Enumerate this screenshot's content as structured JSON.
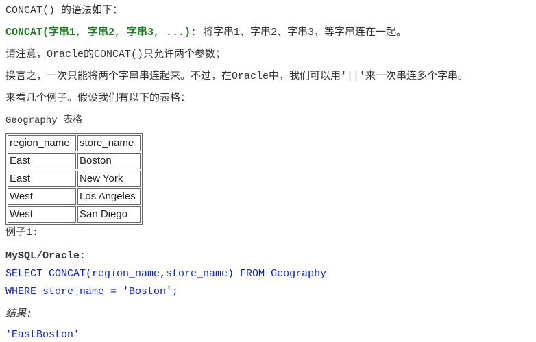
{
  "lines": {
    "intro": "CONCAT() 的语法如下：",
    "syntax_code": "CONCAT(字串1, 字串2, 字串3, ...)",
    "syntax_desc": ": 将字串1、字串2、字串3，等字串连在一起。",
    "note1": "请注意，Oracle的CONCAT()只允许两个参数；",
    "note2": "换言之，一次只能将两个字串串连起来。不过，在Oracle中，我们可以用'||'来一次串连多个字串。",
    "example_intro": "来看几个例子。假设我们有以下的表格：",
    "table_caption": "Geography 表格",
    "example1": "例子1:",
    "db_label": "MySQL/Oracle",
    "db_colon": ":",
    "sql1": "SELECT CONCAT(region_name,store_name) FROM Geography",
    "sql2": "WHERE store_name = 'Boston';",
    "result_label": "结果:",
    "result_value": "'EastBoston'"
  },
  "table": {
    "headers": [
      "region_name",
      "store_name"
    ],
    "rows": [
      [
        "East",
        "Boston"
      ],
      [
        "East",
        "New York"
      ],
      [
        "West",
        "Los Angeles"
      ],
      [
        "West",
        "San Diego"
      ]
    ]
  }
}
